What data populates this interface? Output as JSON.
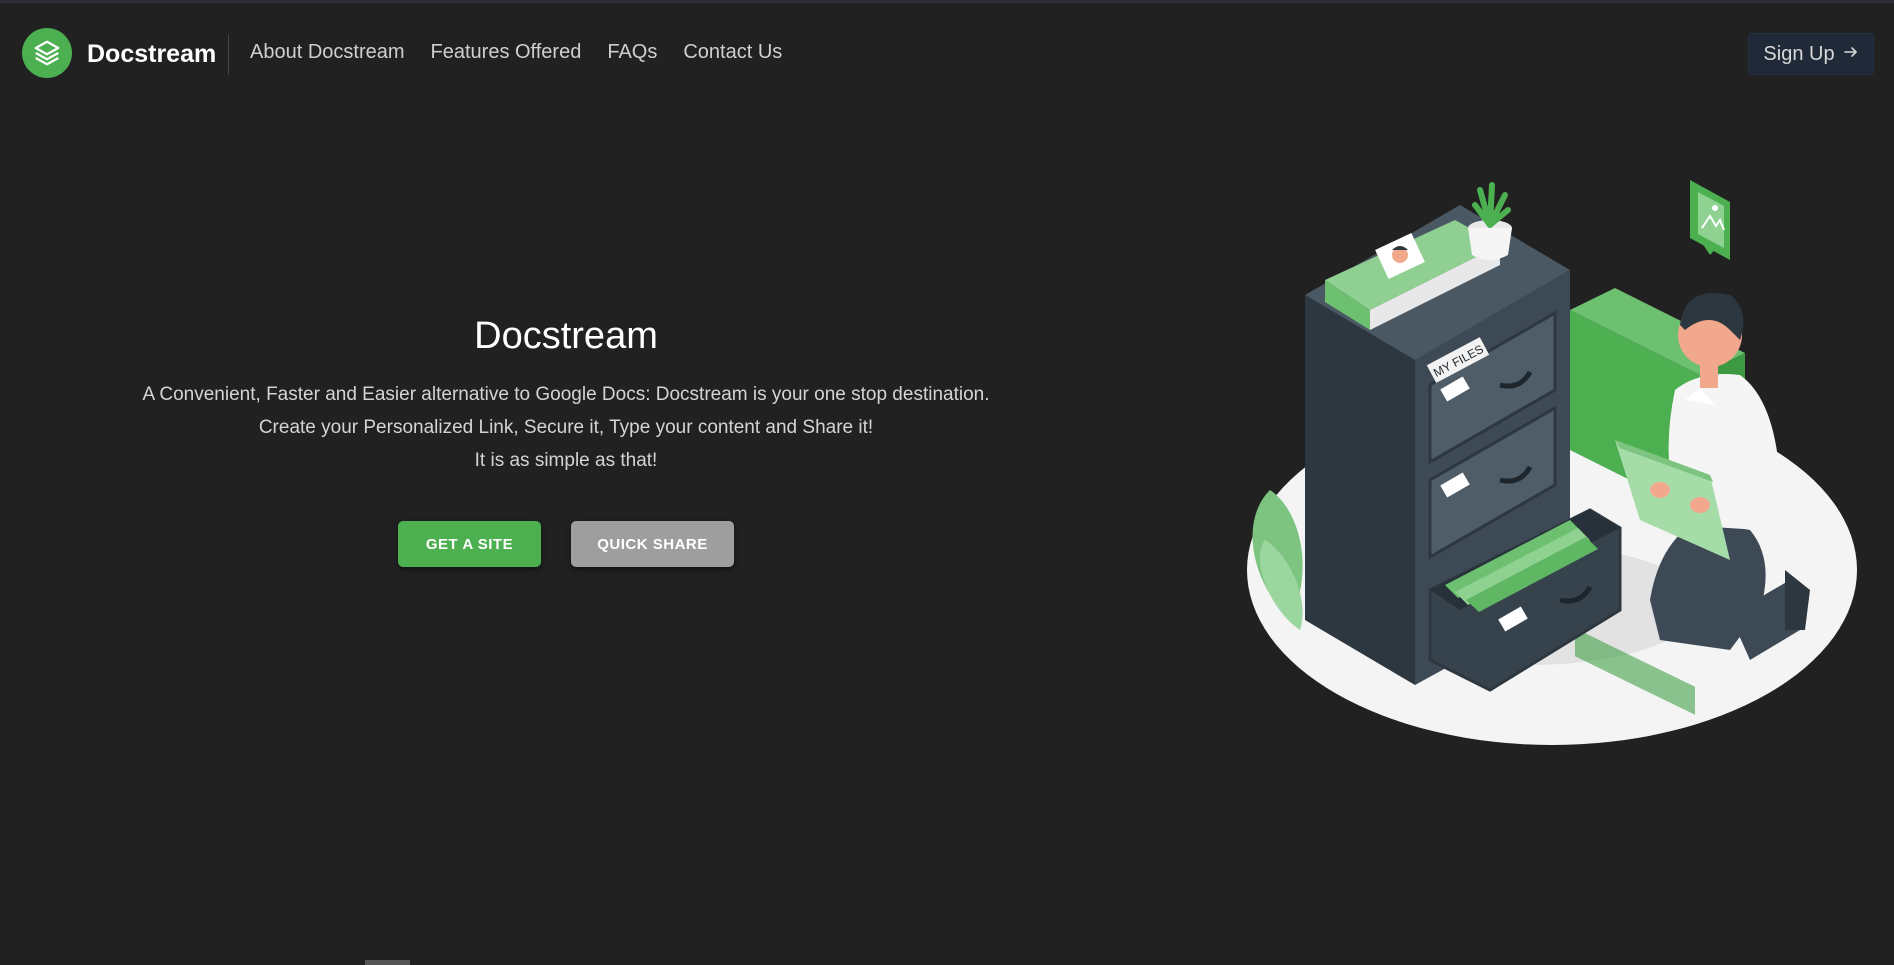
{
  "header": {
    "brand": "Docstream",
    "nav": [
      "About Docstream",
      "Features Offered",
      "FAQs",
      "Contact Us"
    ],
    "signup_label": "Sign Up"
  },
  "hero": {
    "title": "Docstream",
    "lines": [
      "A Convenient, Faster and Easier alternative to Google Docs: Docstream is your one stop destination.",
      "Create your Personalized Link, Secure it, Type your content and Share it!",
      "It is as simple as that!"
    ],
    "primary_button": "GET A SITE",
    "secondary_button": "QUICK SHARE"
  },
  "illustration": {
    "drawer_label": "MY FILES"
  },
  "colors": {
    "background": "#212121",
    "accent": "#4caf50",
    "secondary_button": "#9e9e9e",
    "signup_bg": "#1f2937"
  },
  "icons": [
    "layers-icon",
    "arrow-right-icon",
    "image-icon"
  ]
}
